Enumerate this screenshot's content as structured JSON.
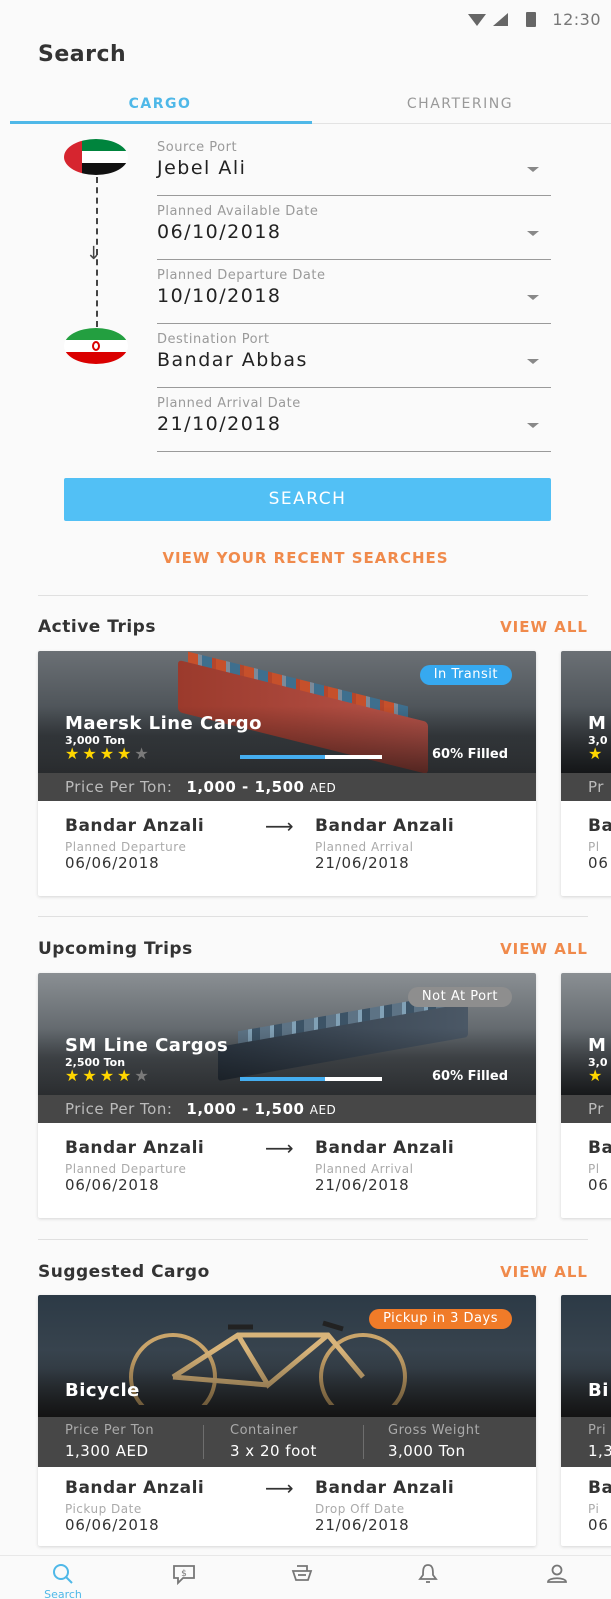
{
  "status_bar": {
    "time": "12:30"
  },
  "header": {
    "title": "Search"
  },
  "tabs": [
    {
      "label": "CARGO"
    },
    {
      "label": "CHARTERING"
    }
  ],
  "form": {
    "source_port": {
      "label": "Source Port",
      "value": "Jebel Ali"
    },
    "available_date": {
      "label": "Planned Available Date",
      "value": "06/10/2018"
    },
    "departure_date": {
      "label": "Planned Departure Date",
      "value": "10/10/2018"
    },
    "destination_port": {
      "label": "Destination Port",
      "value": "Bandar Abbas"
    },
    "arrival_date": {
      "label": "Planned Arrival Date",
      "value": "21/10/2018"
    },
    "search_button": "SEARCH",
    "recent_link": "VIEW YOUR RECENT SEARCHES"
  },
  "sections": {
    "active": {
      "title": "Active Trips",
      "view_all": "VIEW ALL",
      "card": {
        "status": "In Transit",
        "name": "Maersk Line Cargo",
        "tons": "3,000 Ton",
        "rating": 4,
        "fill_fraction": 0.6,
        "fill_label": "60% Filled",
        "price_label": "Price Per Ton:",
        "price_range": "1,000 - 1,500",
        "currency": "AED",
        "from": "Bandar Anzali",
        "to": "Bandar Anzali",
        "from_sub": "Planned Departure",
        "to_sub": "Planned Arrival",
        "from_date": "06/06/2018",
        "to_date": "21/06/2018"
      },
      "peek": {
        "name": "M",
        "tons": "3,0",
        "price": "Pr",
        "from": "Ba",
        "sub": "Pl",
        "date": "06"
      }
    },
    "upcoming": {
      "title": "Upcoming Trips",
      "view_all": "VIEW ALL",
      "card": {
        "status": "Not At Port",
        "name": "SM Line Cargos",
        "tons": "2,500 Ton",
        "rating": 4,
        "fill_fraction": 0.6,
        "fill_label": "60% Filled",
        "price_label": "Price Per Ton:",
        "price_range": "1,000 - 1,500",
        "currency": "AED",
        "from": "Bandar Anzali",
        "to": "Bandar Anzali",
        "from_sub": "Planned Departure",
        "to_sub": "Planned Arrival",
        "from_date": "06/06/2018",
        "to_date": "21/06/2018"
      },
      "peek": {
        "name": "M",
        "tons": "3,0",
        "price": "Pr",
        "from": "Ba",
        "sub": "Pl",
        "date": "06"
      }
    },
    "suggested": {
      "title": "Suggested Cargo",
      "view_all": "VIEW ALL",
      "card": {
        "badge": "Pickup in 3 Days",
        "name": "Bicycle",
        "price_label": "Price Per Ton",
        "price_value": "1,300 AED",
        "container_label": "Container",
        "container_value": "3 x 20 foot",
        "weight_label": "Gross Weight",
        "weight_value": "3,000 Ton",
        "from": "Bandar Anzali",
        "to": "Bandar Anzali",
        "from_sub": "Pickup Date",
        "to_sub": "Drop Off Date",
        "from_date": "06/06/2018",
        "to_date": "21/06/2018"
      },
      "peek": {
        "name": "Bi",
        "price": "Pri",
        "value": "1,3",
        "from": "Ba",
        "sub": "Pi",
        "date": "06"
      }
    }
  },
  "bottom_nav": [
    {
      "label": "Search",
      "icon": "search-icon",
      "active": true
    },
    {
      "label": "",
      "icon": "chat-dollar-icon"
    },
    {
      "label": "",
      "icon": "ship-icon"
    },
    {
      "label": "",
      "icon": "bell-icon"
    },
    {
      "label": "",
      "icon": "user-icon"
    }
  ],
  "colors": {
    "accent": "#4fb8e8",
    "link": "#f08a4b",
    "stars": "#ffd600"
  }
}
